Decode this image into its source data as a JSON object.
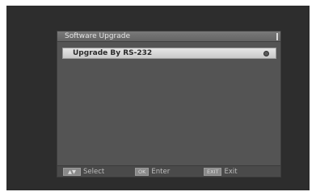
{
  "dialog": {
    "title": "Software Upgrade"
  },
  "menu": {
    "items": [
      {
        "label": "Upgrade By RS-232",
        "icon": "radio-dot-icon"
      }
    ]
  },
  "footer": {
    "select": {
      "key": "▲▼",
      "label": "Select"
    },
    "enter": {
      "key": "OK",
      "label": "Enter"
    },
    "exit": {
      "key": "EXIT",
      "label": "Exit"
    }
  },
  "colors": {
    "screen_background": "#2d2d2d",
    "panel_background": "#545454",
    "highlight": "#d9d9d9"
  }
}
